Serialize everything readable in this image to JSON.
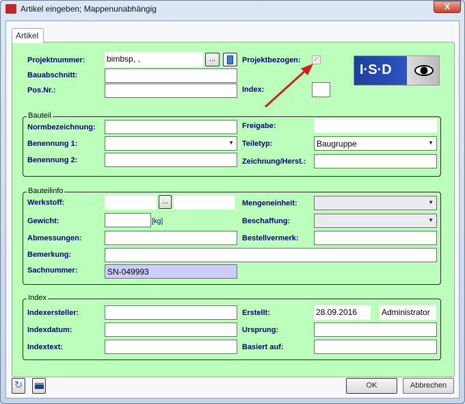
{
  "window": {
    "title": "Artikel eingeben; Mappenunabhängig",
    "close": "X"
  },
  "tab": "Artikel",
  "top": {
    "projektnummer_label": "Projektnummer:",
    "projektnummer_value": "bimbsp, ,",
    "browse": "...",
    "bauabschnitt_label": "Bauabschnitt:",
    "posnr_label": "Pos.Nr.:",
    "projektbezogen_label": "Projektbezogen:",
    "projektbezogen_checked": true,
    "index_label": "Index:",
    "logo": "I·S·D"
  },
  "bauteil": {
    "title": "Bauteil",
    "normbezeichnung": "Normbezeichnung:",
    "benennung1": "Benennung 1:",
    "benennung2": "Benennung 2:",
    "freigabe": "Freigabe:",
    "teiletyp": "Teiletyp:",
    "teiletyp_value": "Baugruppe",
    "zeichnung": "Zeichnung/Herst.:"
  },
  "bauteilinfo": {
    "title": "Bauteilinfo",
    "werkstoff": "Werkstoff:",
    "browse": "...",
    "gewicht": "Gewicht:",
    "unit": "[kg]",
    "abmessungen": "Abmessungen:",
    "bemerkung": "Bemerkung:",
    "sachnummer": "Sachnummer:",
    "sachnummer_value": "SN-049993",
    "mengeneinheit": "Mengeneinheit:",
    "beschaffung": "Beschaffung:",
    "bestellvermerk": "Bestellvermerk:"
  },
  "index": {
    "title": "Index",
    "indexersteller": "Indexersteller:",
    "indexdatum": "Indexdatum:",
    "indextext": "Indextext:",
    "erstellt": "Erstellt:",
    "erstellt_date": "28.09.2016",
    "erstellt_user": "Administrator",
    "ursprung": "Ursprung:",
    "basiert": "Basiert auf:"
  },
  "buttons": {
    "ok": "OK",
    "cancel": "Abbrechen"
  },
  "colors": {
    "panel": "#bbffbb",
    "label": "#000080",
    "highlight": "#ccccff"
  }
}
